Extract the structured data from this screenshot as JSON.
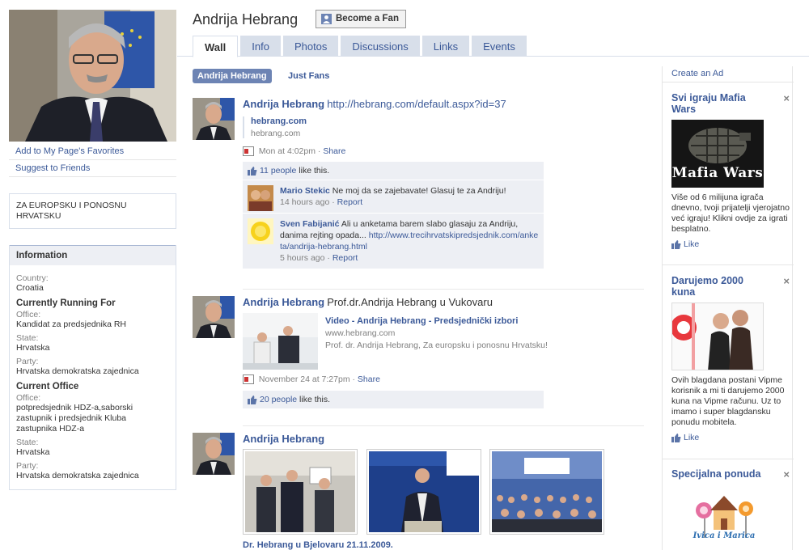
{
  "header": {
    "page_name": "Andrija Hebrang",
    "fan_button": "Become a Fan"
  },
  "tabs": [
    {
      "label": "Wall",
      "active": true
    },
    {
      "label": "Info"
    },
    {
      "label": "Photos"
    },
    {
      "label": "Discussions"
    },
    {
      "label": "Links"
    },
    {
      "label": "Events"
    }
  ],
  "left": {
    "favorites_link": "Add to My Page's Favorites",
    "suggest_link": "Suggest to Friends",
    "quote": "ZA EUROPSKU I PONOSNU HRVATSKU",
    "info_title": "Information",
    "country_label": "Country:",
    "country_value": "Croatia",
    "running_title": "Currently Running For",
    "running_office_label": "Office:",
    "running_office_value": "Kandidat za predsjednika RH",
    "running_state_label": "State:",
    "running_state_value": "Hrvatska",
    "running_party_label": "Party:",
    "running_party_value": "Hrvatska demokratska zajednica",
    "current_title": "Current Office",
    "current_office_label": "Office:",
    "current_office_value": "potpredsjednik HDZ-a,saborski zastupnik i predsjednik Kluba zastupnika HDZ-a",
    "current_state_label": "State:",
    "current_state_value": "Hrvatska",
    "current_party_label": "Party:",
    "current_party_value": "Hrvatska demokratska zajednica"
  },
  "filters": {
    "all": "Andrija Hebrang",
    "fans": "Just Fans"
  },
  "stream": {
    "story1": {
      "actor": "Andrija Hebrang",
      "url": "http://hebrang.com/default.aspx?id=37",
      "attach_title": "hebrang.com",
      "attach_sub": "hebrang.com",
      "time": "Mon at 4:02pm",
      "sep": "·",
      "share": "Share",
      "likes_count": "11 people",
      "likes_text": " like this.",
      "comments": [
        {
          "author": "Mario Stekic",
          "text": "Ne moj da se zajebavate! Glasuj te za Andriju!",
          "time": "14 hours ago",
          "report": "Report"
        },
        {
          "author": "Sven Fabijanić",
          "text": "Ali u anketama barem slabo glasaju za Andriju, danima rejting opada...",
          "link": "http://www.trecihrvatskipredsjednik.com/anketa/andrija-hebrang.html",
          "time": "5 hours ago",
          "report": "Report"
        }
      ]
    },
    "story2": {
      "actor": "Andrija Hebrang",
      "text": "Prof.dr.Andrija Hebrang u Vukovaru",
      "attach_title": "Video - Andrija Hebrang - Predsjednički izbori",
      "attach_site": "www.hebrang.com",
      "attach_desc": "Prof. dr. Andrija Hebrang, Za europsku i ponosnu Hrvatsku!",
      "time": "November 24 at 7:27pm",
      "sep": "·",
      "share": "Share",
      "likes_count": "20 people",
      "likes_text": " like this."
    },
    "story3": {
      "actor": "Andrija Hebrang",
      "caption": "Dr. Hebrang u Bjelovaru 21.11.2009."
    }
  },
  "right": {
    "create_ad": "Create an Ad",
    "ads": [
      {
        "title": "Svi igraju Mafia Wars",
        "image_text": "Mafia Wars",
        "text": "Više od 6 milijuna igrača dnevno, tvoji prijatelji vjerojatno već igraju! Klikni ovdje za igrati besplatno.",
        "like": "Like"
      },
      {
        "title": "Darujemo 2000 kuna",
        "text": "Ovih blagdana postani Vipme korisnik a mi ti darujemo 2000 kuna na Vipme računu. Uz to imamo i super blagdansku ponudu mobitela.",
        "like": "Like"
      },
      {
        "title": "Specijalna ponuda",
        "logo_text": "Ivica i Marica"
      }
    ],
    "close": "×"
  },
  "colors": {
    "link": "#3b5998",
    "tab_bg": "#d8dfea",
    "ufi_bg": "#edeff4"
  }
}
